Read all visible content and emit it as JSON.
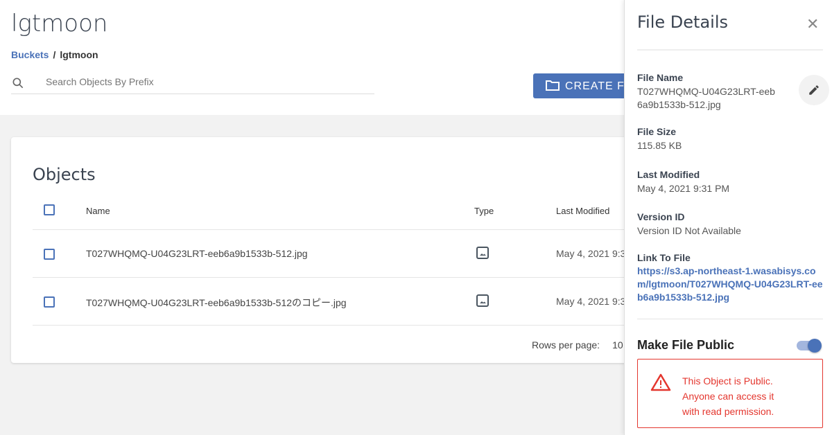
{
  "header": {
    "title": "lgtmoon",
    "breadcrumb": {
      "root": "Buckets",
      "separator": "/",
      "current": "lgtmoon"
    },
    "search_placeholder": "Search Objects By Prefix",
    "create_label": "CREATE F"
  },
  "objects": {
    "title": "Objects",
    "columns": {
      "name": "Name",
      "type": "Type",
      "last_modified": "Last Modified"
    },
    "rows": [
      {
        "name": "T027WHQMQ-U04G23LRT-eeb6a9b1533b-512.jpg",
        "type": "image-icon",
        "date": "May 4, 2021 9:3"
      },
      {
        "name": "T027WHQMQ-U04G23LRT-eeb6a9b1533b-512のコピー.jpg",
        "type": "image-icon",
        "date": "May 4, 2021 9:3"
      }
    ],
    "rows_per_page_label": "Rows per page:",
    "rows_per_page": "10"
  },
  "drawer": {
    "title": "File Details",
    "file_name_label": "File Name",
    "file_name": "T027WHQMQ-U04G23LRT-eeb6a9b1533b-512.jpg",
    "file_size_label": "File Size",
    "file_size": "115.85 KB",
    "last_modified_label": "Last Modified",
    "last_modified": "May 4, 2021 9:31 PM",
    "version_label": "Version ID",
    "version": "Version ID Not Available",
    "link_label": "Link To File",
    "link": "https://s3.ap-northeast-1.wasabisys.com/lgtmoon/T027WHQMQ-U04G23LRT-eeb6a9b1533b-512.jpg",
    "public_label": "Make File Public",
    "public": true,
    "warning": [
      "This Object is Public.",
      "Anyone can access it",
      "with read permission."
    ]
  },
  "colors": {
    "accent": "#4a72b8",
    "warning": "#e4362e"
  }
}
